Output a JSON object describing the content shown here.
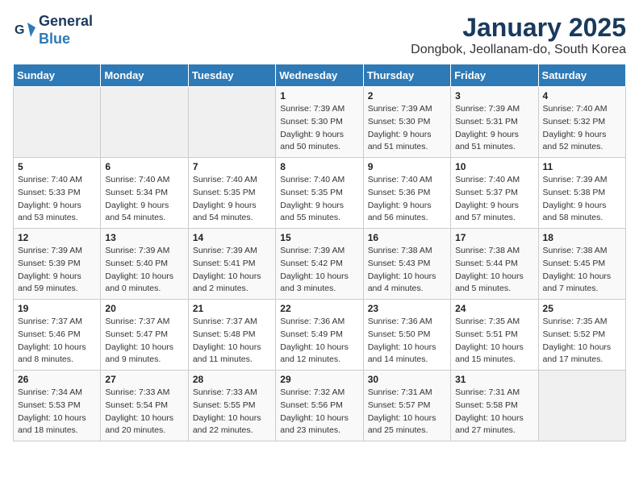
{
  "header": {
    "logo_line1": "General",
    "logo_line2": "Blue",
    "title": "January 2025",
    "subtitle": "Dongbok, Jeollanam-do, South Korea"
  },
  "weekdays": [
    "Sunday",
    "Monday",
    "Tuesday",
    "Wednesday",
    "Thursday",
    "Friday",
    "Saturday"
  ],
  "weeks": [
    [
      {
        "day": "",
        "info": ""
      },
      {
        "day": "",
        "info": ""
      },
      {
        "day": "",
        "info": ""
      },
      {
        "day": "1",
        "info": "Sunrise: 7:39 AM\nSunset: 5:30 PM\nDaylight: 9 hours\nand 50 minutes."
      },
      {
        "day": "2",
        "info": "Sunrise: 7:39 AM\nSunset: 5:30 PM\nDaylight: 9 hours\nand 51 minutes."
      },
      {
        "day": "3",
        "info": "Sunrise: 7:39 AM\nSunset: 5:31 PM\nDaylight: 9 hours\nand 51 minutes."
      },
      {
        "day": "4",
        "info": "Sunrise: 7:40 AM\nSunset: 5:32 PM\nDaylight: 9 hours\nand 52 minutes."
      }
    ],
    [
      {
        "day": "5",
        "info": "Sunrise: 7:40 AM\nSunset: 5:33 PM\nDaylight: 9 hours\nand 53 minutes."
      },
      {
        "day": "6",
        "info": "Sunrise: 7:40 AM\nSunset: 5:34 PM\nDaylight: 9 hours\nand 54 minutes."
      },
      {
        "day": "7",
        "info": "Sunrise: 7:40 AM\nSunset: 5:35 PM\nDaylight: 9 hours\nand 54 minutes."
      },
      {
        "day": "8",
        "info": "Sunrise: 7:40 AM\nSunset: 5:35 PM\nDaylight: 9 hours\nand 55 minutes."
      },
      {
        "day": "9",
        "info": "Sunrise: 7:40 AM\nSunset: 5:36 PM\nDaylight: 9 hours\nand 56 minutes."
      },
      {
        "day": "10",
        "info": "Sunrise: 7:40 AM\nSunset: 5:37 PM\nDaylight: 9 hours\nand 57 minutes."
      },
      {
        "day": "11",
        "info": "Sunrise: 7:39 AM\nSunset: 5:38 PM\nDaylight: 9 hours\nand 58 minutes."
      }
    ],
    [
      {
        "day": "12",
        "info": "Sunrise: 7:39 AM\nSunset: 5:39 PM\nDaylight: 9 hours\nand 59 minutes."
      },
      {
        "day": "13",
        "info": "Sunrise: 7:39 AM\nSunset: 5:40 PM\nDaylight: 10 hours\nand 0 minutes."
      },
      {
        "day": "14",
        "info": "Sunrise: 7:39 AM\nSunset: 5:41 PM\nDaylight: 10 hours\nand 2 minutes."
      },
      {
        "day": "15",
        "info": "Sunrise: 7:39 AM\nSunset: 5:42 PM\nDaylight: 10 hours\nand 3 minutes."
      },
      {
        "day": "16",
        "info": "Sunrise: 7:38 AM\nSunset: 5:43 PM\nDaylight: 10 hours\nand 4 minutes."
      },
      {
        "day": "17",
        "info": "Sunrise: 7:38 AM\nSunset: 5:44 PM\nDaylight: 10 hours\nand 5 minutes."
      },
      {
        "day": "18",
        "info": "Sunrise: 7:38 AM\nSunset: 5:45 PM\nDaylight: 10 hours\nand 7 minutes."
      }
    ],
    [
      {
        "day": "19",
        "info": "Sunrise: 7:37 AM\nSunset: 5:46 PM\nDaylight: 10 hours\nand 8 minutes."
      },
      {
        "day": "20",
        "info": "Sunrise: 7:37 AM\nSunset: 5:47 PM\nDaylight: 10 hours\nand 9 minutes."
      },
      {
        "day": "21",
        "info": "Sunrise: 7:37 AM\nSunset: 5:48 PM\nDaylight: 10 hours\nand 11 minutes."
      },
      {
        "day": "22",
        "info": "Sunrise: 7:36 AM\nSunset: 5:49 PM\nDaylight: 10 hours\nand 12 minutes."
      },
      {
        "day": "23",
        "info": "Sunrise: 7:36 AM\nSunset: 5:50 PM\nDaylight: 10 hours\nand 14 minutes."
      },
      {
        "day": "24",
        "info": "Sunrise: 7:35 AM\nSunset: 5:51 PM\nDaylight: 10 hours\nand 15 minutes."
      },
      {
        "day": "25",
        "info": "Sunrise: 7:35 AM\nSunset: 5:52 PM\nDaylight: 10 hours\nand 17 minutes."
      }
    ],
    [
      {
        "day": "26",
        "info": "Sunrise: 7:34 AM\nSunset: 5:53 PM\nDaylight: 10 hours\nand 18 minutes."
      },
      {
        "day": "27",
        "info": "Sunrise: 7:33 AM\nSunset: 5:54 PM\nDaylight: 10 hours\nand 20 minutes."
      },
      {
        "day": "28",
        "info": "Sunrise: 7:33 AM\nSunset: 5:55 PM\nDaylight: 10 hours\nand 22 minutes."
      },
      {
        "day": "29",
        "info": "Sunrise: 7:32 AM\nSunset: 5:56 PM\nDaylight: 10 hours\nand 23 minutes."
      },
      {
        "day": "30",
        "info": "Sunrise: 7:31 AM\nSunset: 5:57 PM\nDaylight: 10 hours\nand 25 minutes."
      },
      {
        "day": "31",
        "info": "Sunrise: 7:31 AM\nSunset: 5:58 PM\nDaylight: 10 hours\nand 27 minutes."
      },
      {
        "day": "",
        "info": ""
      }
    ]
  ]
}
